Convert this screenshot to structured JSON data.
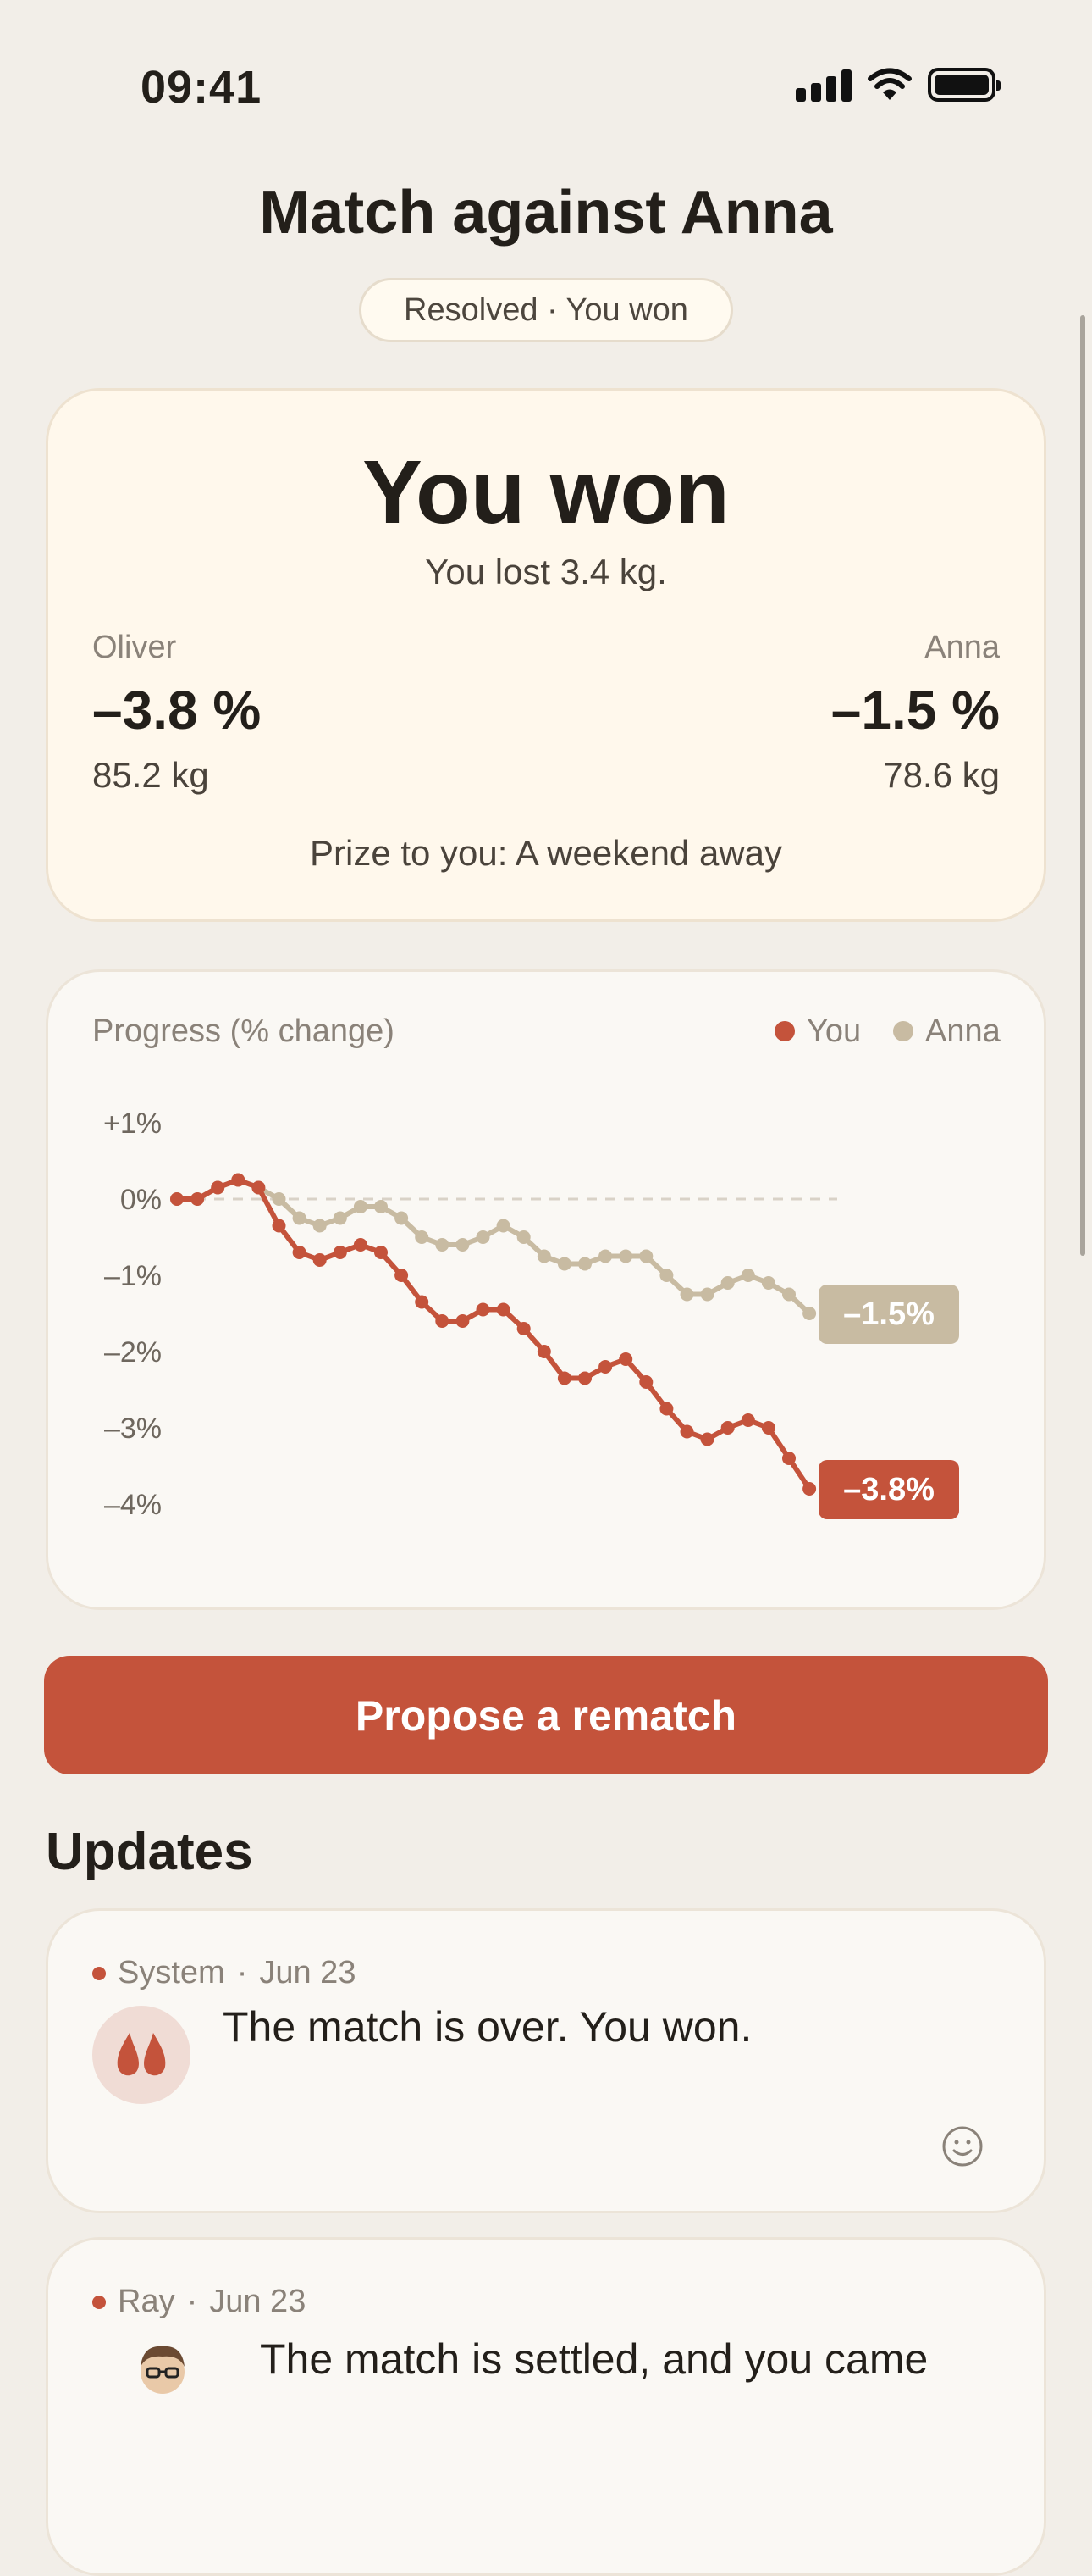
{
  "status_bar": {
    "time": "09:41"
  },
  "header": {
    "title": "Match against Anna",
    "status": "Resolved · You won"
  },
  "result": {
    "title": "You won",
    "subtitle": "You lost 3.4 kg.",
    "left": {
      "name": "Oliver",
      "pct": "–3.8 %",
      "kg": "85.2 kg"
    },
    "right": {
      "name": "Anna",
      "pct": "–1.5 %",
      "kg": "78.6 kg"
    },
    "prize": "Prize to you: A weekend away"
  },
  "chart": {
    "title": "Progress (% change)",
    "legend": [
      {
        "name": "You",
        "color": "#c4533b"
      },
      {
        "name": "Anna",
        "color": "#c8bba2"
      }
    ],
    "y_ticks": [
      "+1%",
      "0%",
      "–1%",
      "–2%",
      "–3%",
      "–4%"
    ],
    "you_end_label": "–3.8%",
    "anna_end_label": "–1.5%"
  },
  "chart_data": {
    "type": "line",
    "title": "Progress (% change)",
    "xlabel": "",
    "ylabel": "",
    "ylim": [
      -4,
      1
    ],
    "y_ticks": [
      1,
      0,
      -1,
      -2,
      -3,
      -4
    ],
    "grid": false,
    "reference_line": 0,
    "legend_position": "top-right",
    "x": [
      1,
      2,
      3,
      4,
      5,
      6,
      7,
      8,
      9,
      10,
      11,
      12,
      13,
      14,
      15,
      16,
      17,
      18,
      19,
      20,
      21,
      22,
      23,
      24,
      25,
      26,
      27,
      28,
      29,
      30,
      31,
      32,
      33
    ],
    "series": [
      {
        "name": "You",
        "color": "#c4533b",
        "end_label": "–3.8%",
        "values": [
          0.0,
          0.0,
          0.15,
          0.25,
          0.15,
          -0.35,
          -0.7,
          -0.8,
          -0.7,
          -0.6,
          -0.7,
          -1.0,
          -1.35,
          -1.6,
          -1.6,
          -1.45,
          -1.45,
          -1.7,
          -2.0,
          -2.35,
          -2.35,
          -2.2,
          -2.1,
          -2.4,
          -2.75,
          -3.05,
          -3.15,
          -3.0,
          -2.9,
          -3.0,
          -3.4,
          -3.8
        ]
      },
      {
        "name": "Anna",
        "color": "#c8bba2",
        "end_label": "–1.5%",
        "values": [
          0.0,
          0.0,
          0.15,
          0.25,
          0.15,
          0.0,
          -0.25,
          -0.35,
          -0.25,
          -0.1,
          -0.1,
          -0.25,
          -0.5,
          -0.6,
          -0.6,
          -0.5,
          -0.35,
          -0.5,
          -0.75,
          -0.85,
          -0.85,
          -0.75,
          -0.75,
          -0.75,
          -1.0,
          -1.25,
          -1.25,
          -1.1,
          -1.0,
          -1.1,
          -1.25,
          -1.5
        ]
      }
    ]
  },
  "actions": {
    "rematch": "Propose a rematch"
  },
  "updates": {
    "title": "Updates",
    "items": [
      {
        "author": "System",
        "date": "Jun 23",
        "text": "The match is over. You won."
      },
      {
        "author": "Ray",
        "date": "Jun 23",
        "text": "The match is settled, and you came"
      }
    ]
  }
}
